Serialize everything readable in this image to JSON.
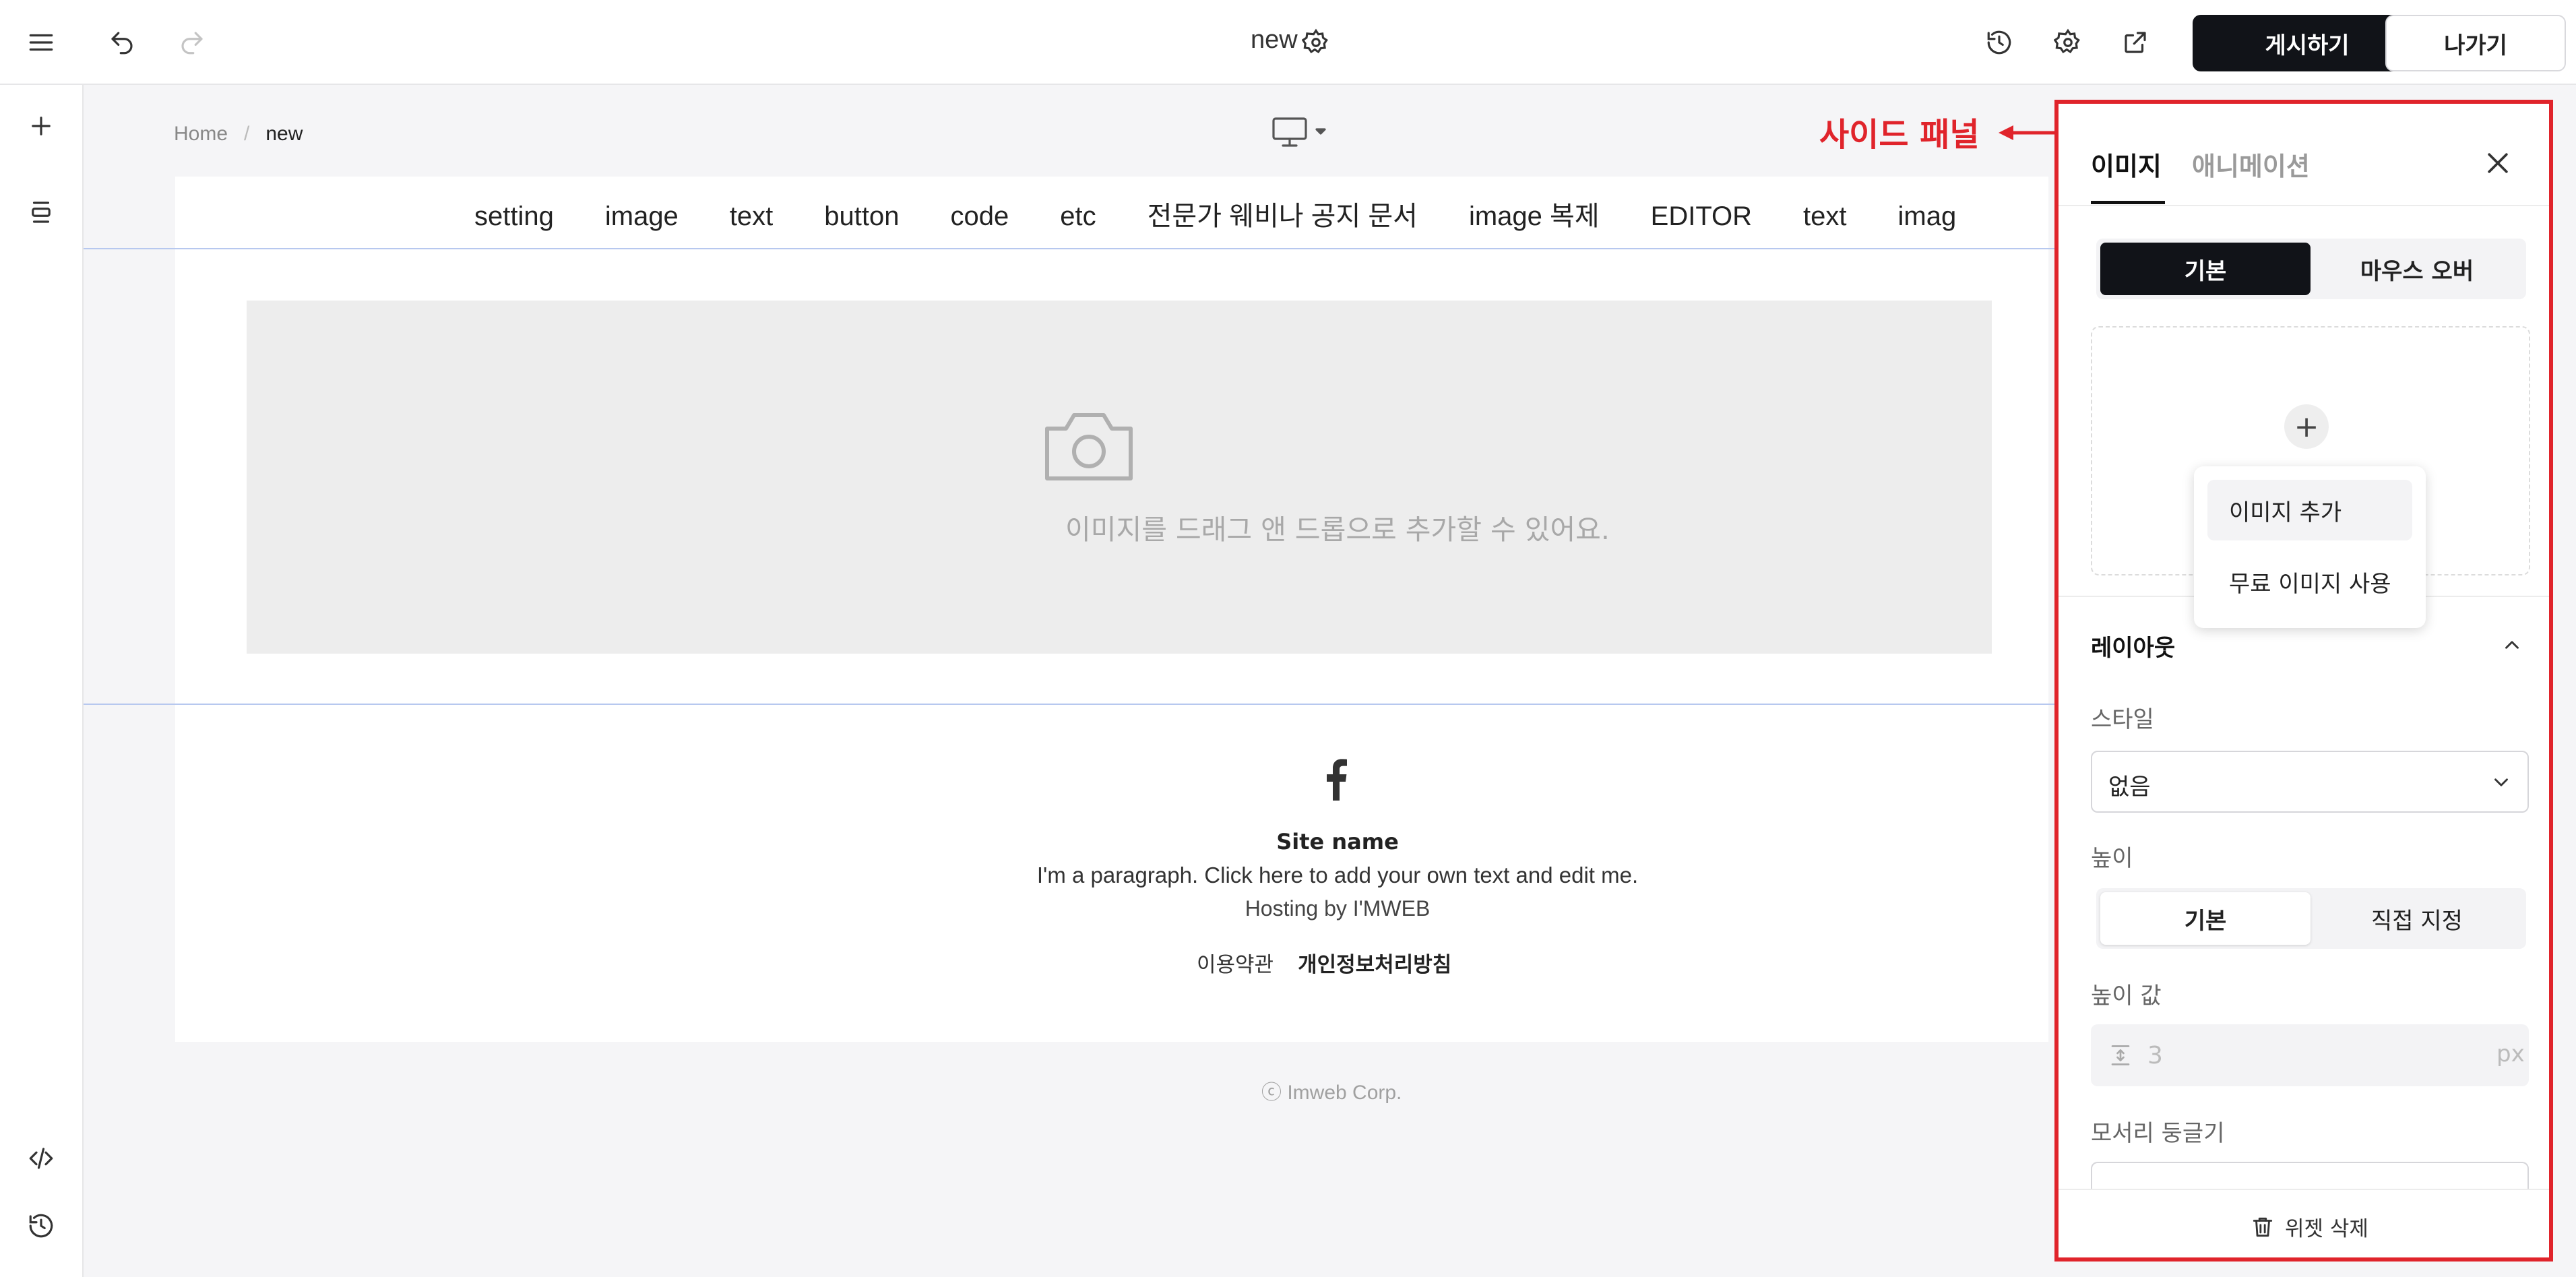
{
  "header": {
    "doc_title": "new",
    "publish_label": "게시하기",
    "exit_label": "나가기"
  },
  "breadcrumb": {
    "home": "Home",
    "separator": "/",
    "current": "new"
  },
  "site_nav": {
    "items": [
      "setting",
      "image",
      "text",
      "button",
      "code",
      "etc",
      "전문가 웨비나 공지 문서",
      "image 복제",
      "EDITOR",
      "text",
      "imag"
    ]
  },
  "image_section": {
    "drop_text": "이미지를 드래그 앤 드롭으로 추가할 수 있어요."
  },
  "footer": {
    "site_name": "Site name",
    "paragraph": "I'm a paragraph. Click here to add your own text and edit me.",
    "hosting": "Hosting by I'MWEB",
    "terms_label": "이용약관",
    "privacy_label": "개인정보처리방침",
    "copyright": "ⓒ Imweb Corp."
  },
  "annotation": {
    "label": "사이드 패널",
    "color": "#e0242b"
  },
  "side_panel": {
    "tabs": [
      "이미지",
      "애니메이션"
    ],
    "mode_options": [
      "기본",
      "마우스 오버"
    ],
    "upload_menu": [
      "이미지 추가",
      "무료 이미지 사용"
    ],
    "layout_title": "레이아웃",
    "style_label": "스타일",
    "style_value": "없음",
    "height_label": "높이",
    "height_options": [
      "기본",
      "직접 지정"
    ],
    "height_value_label": "높이 값",
    "height_value": "3",
    "height_unit": "px",
    "corner_label": "모서리 둥글기",
    "delete_label": "위젯 삭제"
  },
  "colors": {
    "primary_dark": "#111318",
    "guide_line": "#b7c8ef"
  }
}
